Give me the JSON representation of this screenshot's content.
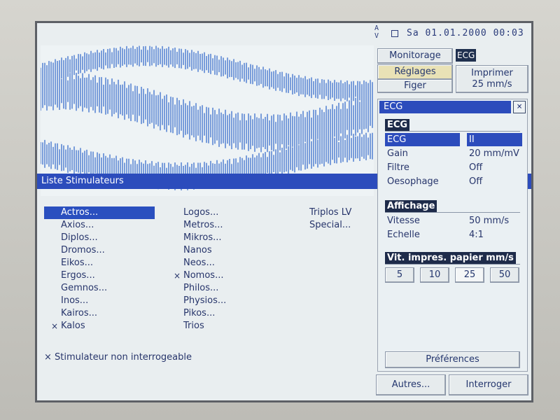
{
  "status": {
    "av": [
      "A",
      "V"
    ],
    "datetime": "Sa 01.01.2000 00:03"
  },
  "toolbar": {
    "monitorage": "Monitorage",
    "mode_badge": "ECG",
    "reglages": "Réglages",
    "figer": "Figer",
    "imprimer_line1": "Imprimer",
    "imprimer_line2": "25 mm/s"
  },
  "list": {
    "title": "Liste Stimulateurs",
    "col1": [
      "Actros...",
      "Axios...",
      "Diplos...",
      "Dromos...",
      "Eikos...",
      "Ergos...",
      "Gemnos...",
      "Inos...",
      "Kairos...",
      "Kalos"
    ],
    "col2": [
      "Logos...",
      "Metros...",
      "Mikros...",
      "Nanos",
      "Neos...",
      "Nomos...",
      "Philos...",
      "Physios...",
      "Pikos...",
      "Trios"
    ],
    "col3": [
      "Triplos LV",
      "Special..."
    ],
    "marker": "×",
    "footnote": "× Stimulateur non interrogeable"
  },
  "dialog": {
    "title": "ECG",
    "close": "×",
    "section_ecg": "ECG",
    "ecg_rows": [
      {
        "label": "ECG",
        "value": "II"
      },
      {
        "label": "Gain",
        "value": "20 mm/mV"
      },
      {
        "label": "Filtre",
        "value": "Off"
      },
      {
        "label": "Oesophage",
        "value": "Off"
      }
    ],
    "section_affichage": "Affichage",
    "aff_rows": [
      {
        "label": "Vitesse",
        "value": "50 mm/s"
      },
      {
        "label": "Echelle",
        "value": "4:1"
      }
    ],
    "section_vit": "Vit. impres. papier mm/s",
    "speeds": [
      "5",
      "10",
      "25",
      "50"
    ],
    "preferences": "Préférences"
  },
  "bottom": {
    "autres": "Autres...",
    "interroger": "Interroger"
  },
  "colors": {
    "accent": "#2c4cbc",
    "text": "#27356b",
    "waveform": "#2b63c8"
  }
}
